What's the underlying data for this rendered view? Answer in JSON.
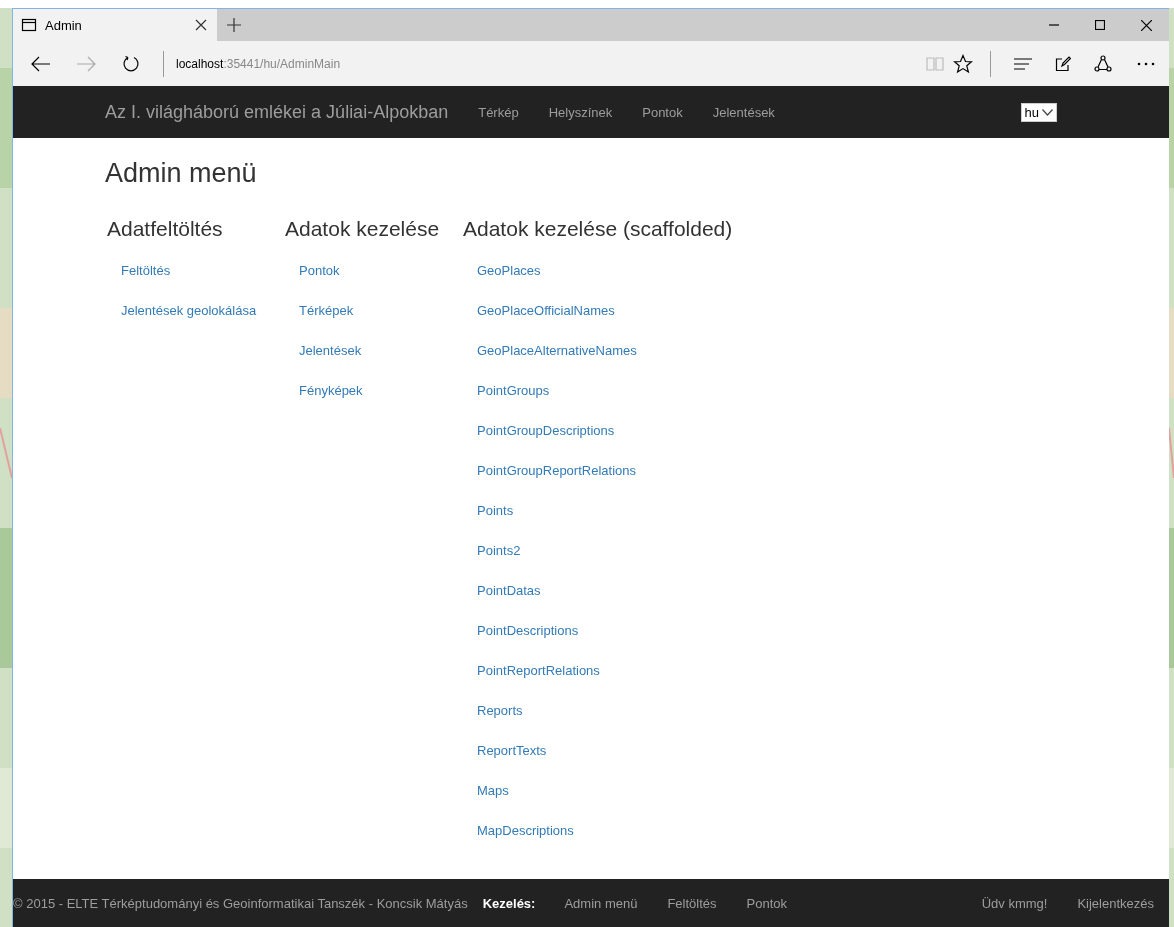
{
  "browser": {
    "tab": {
      "title": "Admin",
      "selected": true
    },
    "address": {
      "host": "localhost",
      "path": ":35441/hu/AdminMain"
    }
  },
  "navbar": {
    "brand": "Az I. világháború emlékei a Júliai-Alpokban",
    "links": [
      "Térkép",
      "Helyszínek",
      "Pontok",
      "Jelentések"
    ],
    "language": "hu"
  },
  "page_title": "Admin menü",
  "sections": [
    {
      "heading": "Adatfeltöltés",
      "links": [
        "Feltöltés",
        "Jelentések geolokálása"
      ]
    },
    {
      "heading": "Adatok kezelése",
      "links": [
        "Pontok",
        "Térképek",
        "Jelentések",
        "Fényképek"
      ]
    },
    {
      "heading": "Adatok kezelése (scaffolded)",
      "links": [
        "GeoPlaces",
        "GeoPlaceOfficialNames",
        "GeoPlaceAlternativeNames",
        "PointGroups",
        "PointGroupDescriptions",
        "PointGroupReportRelations",
        "Points",
        "Points2",
        "PointDatas",
        "PointDescriptions",
        "PointReportRelations",
        "Reports",
        "ReportTexts",
        "Maps",
        "MapDescriptions"
      ]
    }
  ],
  "footer": {
    "copyright": "© 2015 - ELTE Térképtudományi és Geoinformatikai Tanszék - Koncsik Mátyás",
    "label": "Kezelés:",
    "links": [
      "Admin menü",
      "Feltöltés",
      "Pontok"
    ],
    "greeting": "Üdv kmmg!",
    "logout": "Kijelentkezés"
  }
}
